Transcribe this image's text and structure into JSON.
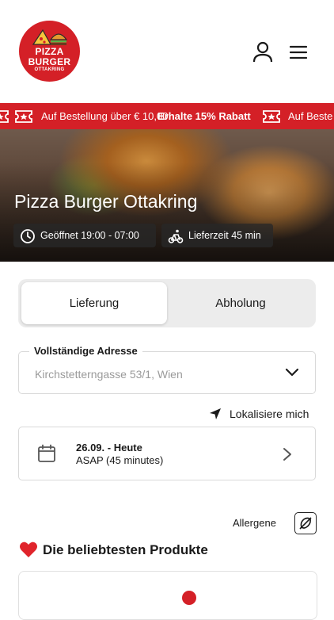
{
  "brand": {
    "logo_line1": "PIZZA",
    "logo_line2": "BURGER",
    "logo_line3": "OTTAKRING",
    "accent_color": "#d42027"
  },
  "header": {
    "icons": [
      "user-icon",
      "hamburger-menu-icon"
    ]
  },
  "ticker": {
    "item_text": "Auf Bestellung über € 10,00",
    "highlight_text": "Erhalte 15% Rabatt",
    "trailing_text": "Auf Beste",
    "icon": "ticket-star-icon"
  },
  "hero": {
    "title": "Pizza Burger Ottakring",
    "open_hours": "Geöffnet 19:00 - 07:00",
    "delivery_time": "Lieferzeit 45 min"
  },
  "order_mode": {
    "options": [
      "Lieferung",
      "Abholung"
    ],
    "selected": "Lieferung"
  },
  "address": {
    "label": "Vollständige Adresse",
    "value": "Kirchstetterngasse 53/1, Wien"
  },
  "locate": {
    "label": "Lokalisiere mich"
  },
  "schedule": {
    "date": "26.09. - Heute",
    "time": "ASAP (45 minutes)"
  },
  "allergens": {
    "label": "Allergene"
  },
  "popular": {
    "heading": "Die beliebtesten Produkte"
  }
}
